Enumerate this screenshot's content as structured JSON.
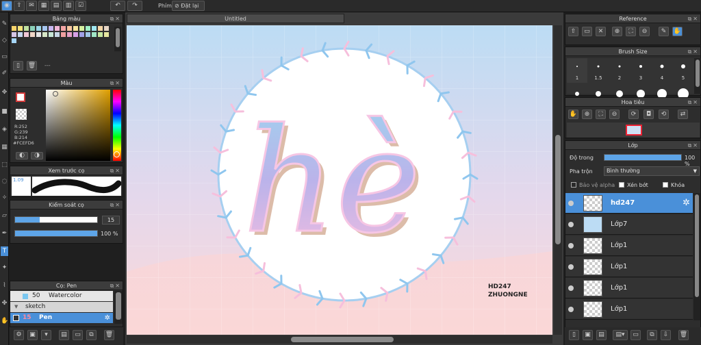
{
  "topbar": {
    "undo_icon": "undo-icon",
    "redo_icon": "redo-icon",
    "shortcut_label": "Phím",
    "reset_label": "Đặt lại"
  },
  "palette_panel": {
    "title": "Bảng màu",
    "dash": "---",
    "swatches": [
      "#f7d46b",
      "#f4e27a",
      "#bfe0a0",
      "#8ad0b8",
      "#9cd6e6",
      "#a6c6f0",
      "#c7b6f0",
      "#f0b6d6",
      "#f4a6a6",
      "#f7c6a0",
      "#f7e6a0",
      "#d6f0a0",
      "#a0f0c6",
      "#a0e6f0",
      "#f4d6a6",
      "#e6d6c6",
      "#d6c6e6",
      "#c6d6f0",
      "#f0c6d6",
      "#f0d6c6",
      "#e6e6e6",
      "#d6e6c6",
      "#c6e6d6",
      "#c6d6e6",
      "#f0a0a0",
      "#e6a0c6",
      "#d6a0e6",
      "#a0a0e6",
      "#a0c6e6",
      "#a0e6c6",
      "#c6e6a0",
      "#e6e6a0",
      "#a6d6f7"
    ]
  },
  "color_panel": {
    "title": "Màu",
    "r": "R:252",
    "g": "G:239",
    "b": "B:214",
    "hex": "#FCEFD6",
    "fg_color": "#f4f4f4",
    "bg_color": "#d43a3a"
  },
  "brush_preview_panel": {
    "title": "Xem trước cọ",
    "size": "1.09"
  },
  "brush_control_panel": {
    "title": "Kiểm soát cọ",
    "size_value": "15",
    "size_fraction": 0.3,
    "opacity_value": "100 %",
    "opacity_fraction": 1.0
  },
  "brush_list_panel": {
    "title": "Cọ: Pen",
    "items": [
      {
        "size": "50",
        "name": "Watercolor"
      },
      {
        "size": "",
        "name": "sketch"
      },
      {
        "size": "15",
        "name": "Pen"
      }
    ]
  },
  "document": {
    "tab_title": "Untitled",
    "artwork_text": "hè",
    "signature_line1": "HD247",
    "signature_line2": "ZHUONGNE"
  },
  "reference_panel": {
    "title": "Reference"
  },
  "brush_size_panel": {
    "title": "Brush Size",
    "sizes": [
      "1",
      "1.5",
      "2",
      "3",
      "4",
      "5"
    ]
  },
  "navigator_panel": {
    "title": "Hoa tiêu"
  },
  "layer_panel": {
    "title": "Lớp",
    "opacity_label": "Độ trong",
    "opacity_value": "100 %",
    "blend_label": "Pha trộn",
    "blend_value": "Bình thường",
    "protect_alpha": "Bảo vệ alpha",
    "clipping": "Xén bớt",
    "lock": "Khóa",
    "layers": [
      {
        "name": "hd247",
        "selected": true
      },
      {
        "name": "Lớp7",
        "selected": false
      },
      {
        "name": "Lớp1",
        "selected": false
      },
      {
        "name": "Lớp1",
        "selected": false
      },
      {
        "name": "Lớp1",
        "selected": false
      },
      {
        "name": "Lớp1",
        "selected": false
      }
    ]
  }
}
